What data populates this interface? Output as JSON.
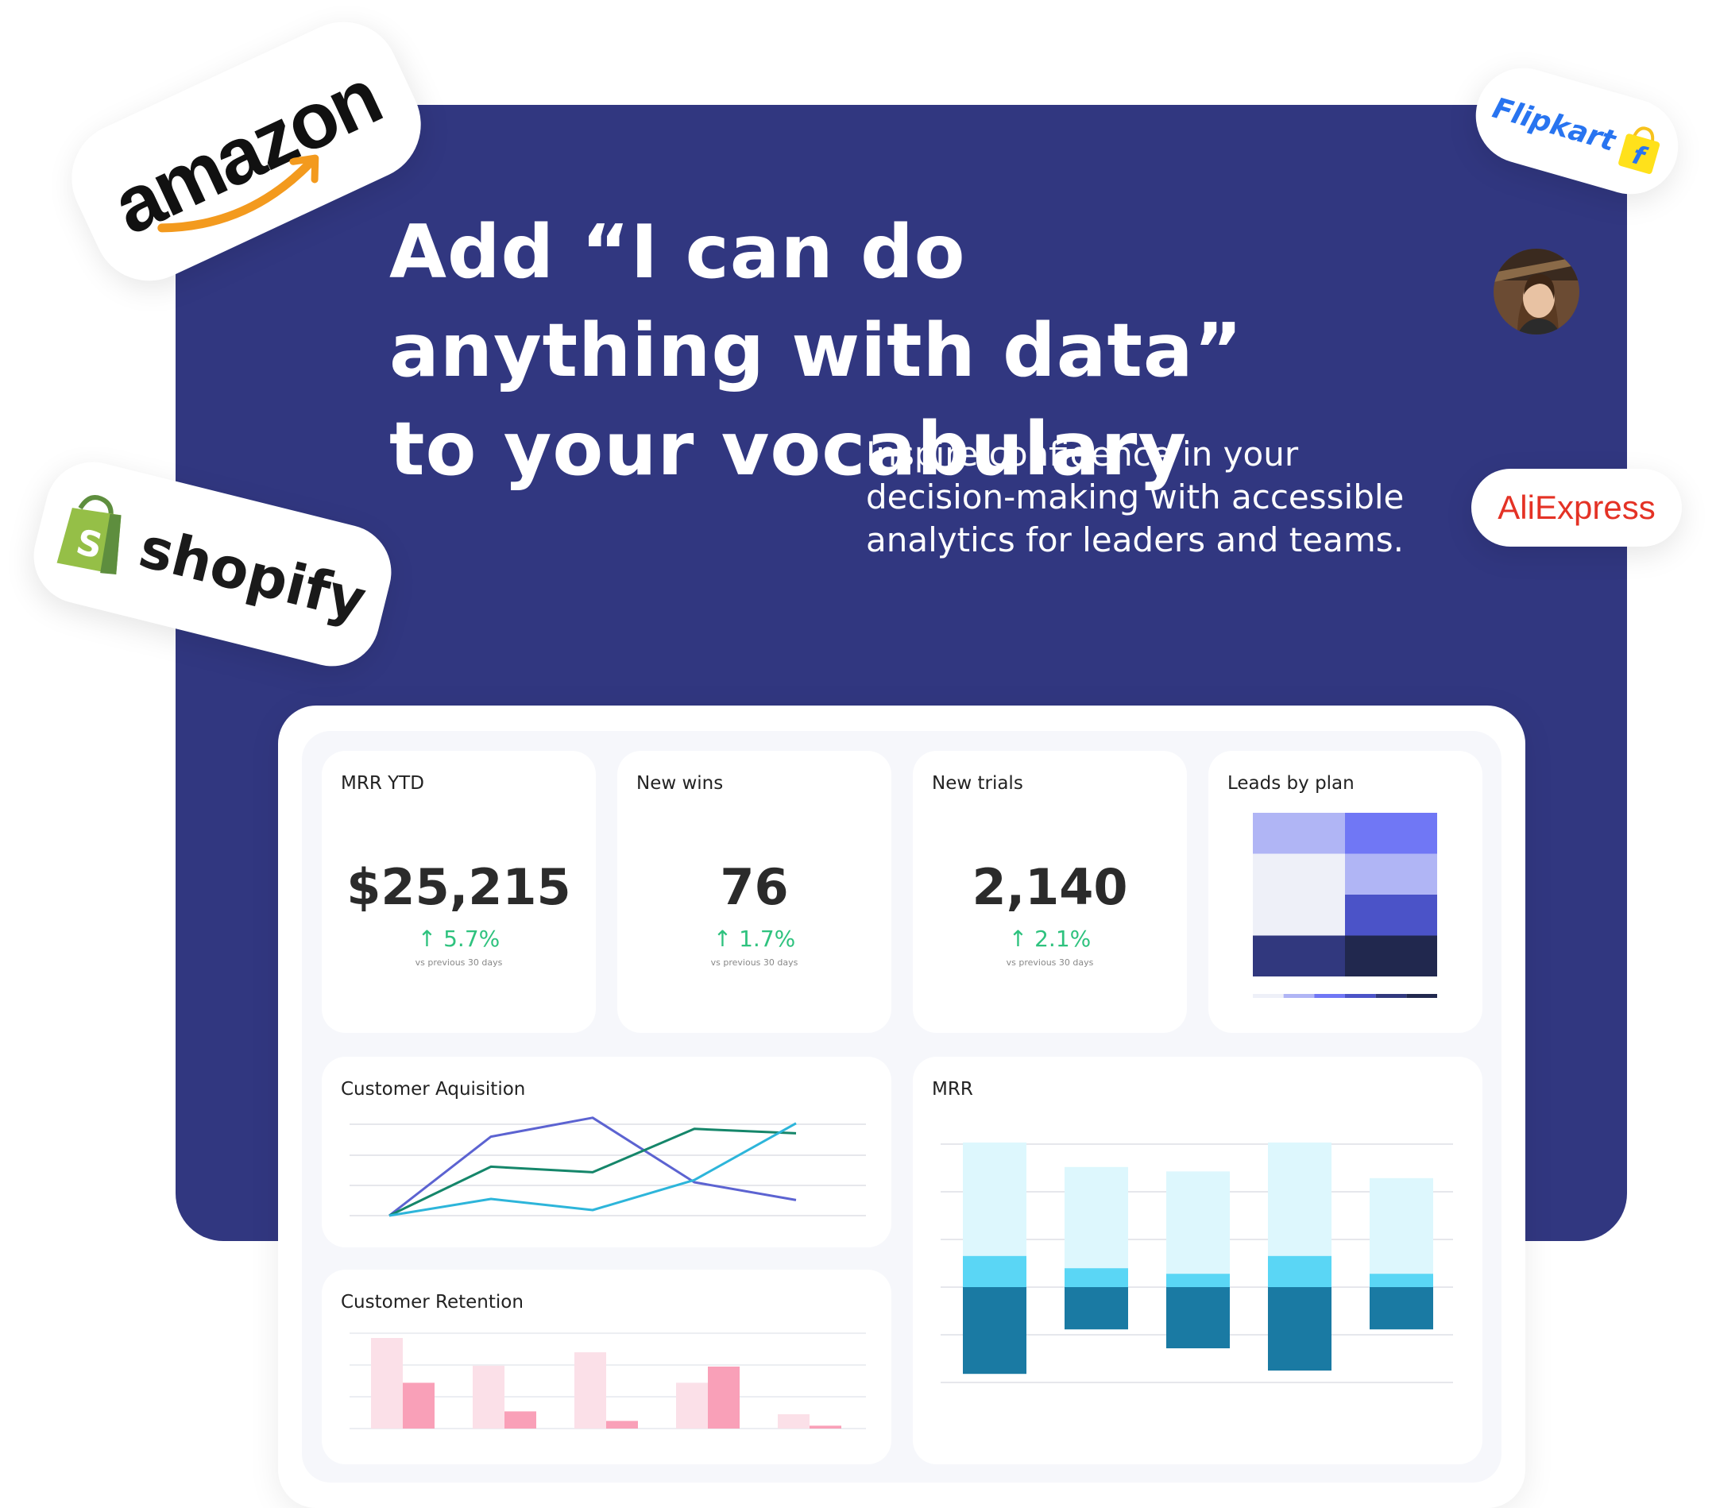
{
  "hero": {
    "headline": "Add “I can do anything with data” to your vocabulary",
    "subtext": "Inspire confidence in your decision-making with accessible analytics for leaders and teams.",
    "background": "#313780"
  },
  "logos": {
    "amazon": "amazon",
    "shopify": "shopify",
    "flipkart": "Flipkart",
    "aliexpress": "AliExpress"
  },
  "kpis": [
    {
      "title": "MRR YTD",
      "value": "$25,215",
      "change": "↑ 5.7%",
      "note": "vs previous 30 days"
    },
    {
      "title": "New wins",
      "value": "76",
      "change": "↑ 1.7%",
      "note": "vs previous 30 days"
    },
    {
      "title": "New trials",
      "value": "2,140",
      "change": "↑ 2.1%",
      "note": "vs previous 30 days"
    }
  ],
  "colors": {
    "up": "#2ec27e",
    "blue_dark": "#1a7aa3",
    "blue_mid": "#5ad6f5",
    "blue_light": "#ddf7fd",
    "pink_dark": "#f9a0b8",
    "pink_light": "#fbe0e8"
  },
  "chart_data": [
    {
      "type": "heatmap",
      "title": "Leads by plan",
      "values": [
        [
          1,
          2
        ],
        [
          0,
          1
        ],
        [
          0,
          3
        ],
        [
          4,
          5
        ]
      ],
      "palette": [
        "#eef0f8",
        "#b0b5f5",
        "#7077f5",
        "#4b53c8",
        "#31387e",
        "#21284e"
      ]
    },
    {
      "type": "line",
      "title": "Customer Aquisition",
      "x": [
        1,
        2,
        3,
        4,
        5
      ],
      "series": [
        {
          "color": "#5c63d1",
          "values": [
            0,
            71,
            88,
            30,
            14
          ]
        },
        {
          "color": "#15866a",
          "values": [
            0,
            44,
            39,
            78,
            74
          ]
        },
        {
          "color": "#2db5da",
          "values": [
            0,
            15,
            5,
            32,
            83
          ]
        }
      ],
      "ylim": [
        0,
        100
      ]
    },
    {
      "type": "bar",
      "title": "Customer Retention",
      "categories": [
        "1",
        "2",
        "3",
        "4",
        "5"
      ],
      "series": [
        {
          "color": "#fbe0e8",
          "values": [
            95,
            66,
            80,
            48,
            15
          ]
        },
        {
          "color": "#f9a0b8",
          "values": [
            48,
            18,
            8,
            65,
            3
          ]
        }
      ],
      "ylim": [
        0,
        100
      ]
    },
    {
      "type": "bar",
      "title": "MRR",
      "categories": [
        "1",
        "2",
        "3",
        "4",
        "5"
      ],
      "series": [
        {
          "color": "#ddf7fd",
          "values": [
            102,
            91,
            92,
            102,
            86
          ]
        },
        {
          "color": "#5ad6f5",
          "values": [
            28,
            17,
            12,
            28,
            12
          ]
        },
        {
          "color": "#1a7aa3",
          "values": [
            -78,
            -38,
            -55,
            -75,
            -38
          ]
        }
      ],
      "ylim": [
        -90,
        130
      ]
    }
  ]
}
